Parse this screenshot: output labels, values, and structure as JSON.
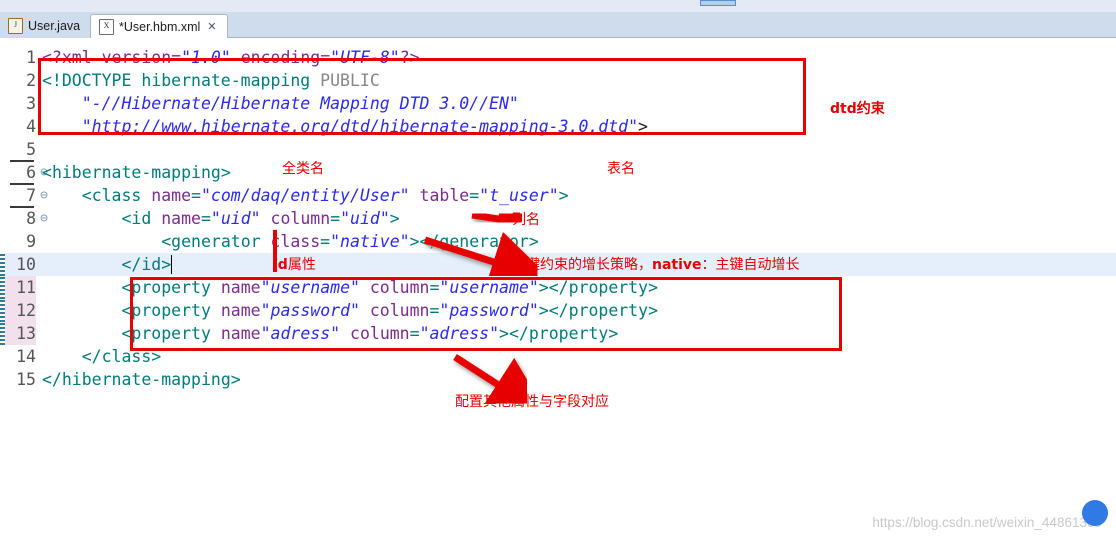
{
  "window": {
    "top_strip_widget": ""
  },
  "tabs": [
    {
      "label": "User.java",
      "icon": "java-file-icon",
      "icon_glyph": "J",
      "dirty": false,
      "active": false,
      "close": ""
    },
    {
      "label": "*User.hbm.xml",
      "icon": "xml-file-icon",
      "icon_glyph": "X",
      "dirty": true,
      "active": true,
      "close": "✕"
    }
  ],
  "editor": {
    "language": "xml",
    "caret_line": 10,
    "current_line": 10,
    "changed_lines": [
      11,
      12,
      13
    ],
    "lines": [
      {
        "n": "1",
        "fold": "",
        "text": "<?xml version=\"1.0\" encoding=\"UTF-8\"?>"
      },
      {
        "n": "2",
        "fold": "",
        "text": "<!DOCTYPE hibernate-mapping PUBLIC"
      },
      {
        "n": "3",
        "fold": "",
        "text": "    \"-//Hibernate/Hibernate Mapping DTD 3.0//EN\""
      },
      {
        "n": "4",
        "fold": "",
        "text": "    \"http://www.hibernate.org/dtd/hibernate-mapping-3.0.dtd\">"
      },
      {
        "n": "5",
        "fold": "",
        "text": ""
      },
      {
        "n": "6",
        "fold": "⊖",
        "text": "<hibernate-mapping>"
      },
      {
        "n": "7",
        "fold": "⊖",
        "text": "    <class name=\"com/daq/entity/User\" table=\"t_user\">"
      },
      {
        "n": "8",
        "fold": "⊖",
        "text": "        <id name=\"uid\" column=\"uid\">"
      },
      {
        "n": "9",
        "fold": "",
        "text": "            <generator class=\"native\"></generator>"
      },
      {
        "n": "10",
        "fold": "",
        "text": "        </id>"
      },
      {
        "n": "11",
        "fold": "",
        "text": "        <property name\"username\" column=\"username\"></property>"
      },
      {
        "n": "12",
        "fold": "",
        "text": "        <property name\"password\" column=\"password\"></property>"
      },
      {
        "n": "13",
        "fold": "",
        "text": "        <property name\"adress\" column=\"adress\"></property>"
      },
      {
        "n": "14",
        "fold": "",
        "text": "    </class>"
      },
      {
        "n": "15",
        "fold": "",
        "text": "</hibernate-mapping>"
      }
    ]
  },
  "annotations": {
    "dtd_label": "dtd约束",
    "class_label": "全类名",
    "table_label": "表名",
    "column_label": "列名",
    "id_attr_label_bold": "id",
    "id_attr_label_rest": "属性",
    "generator_label_pre": "主键约束的增长策略，",
    "generator_label_bold": "native",
    "generator_label_post": "：主键自动增长",
    "property_label": "配置其他属性与字段对应"
  },
  "watermark": {
    "url": "https://blog.csdn.net/weixin_44861399"
  },
  "colors": {
    "annotation_red": "#e60000",
    "tag_teal": "#007b7b",
    "attr_purple": "#7c2b8f",
    "string_blue": "#2a2af0",
    "tab_active_bg": "#ffffff",
    "tab_bar_bg": "#cfdcec",
    "current_line_bg": "#e5eefb",
    "changed_gutter_bg": "#f2e0ed"
  }
}
